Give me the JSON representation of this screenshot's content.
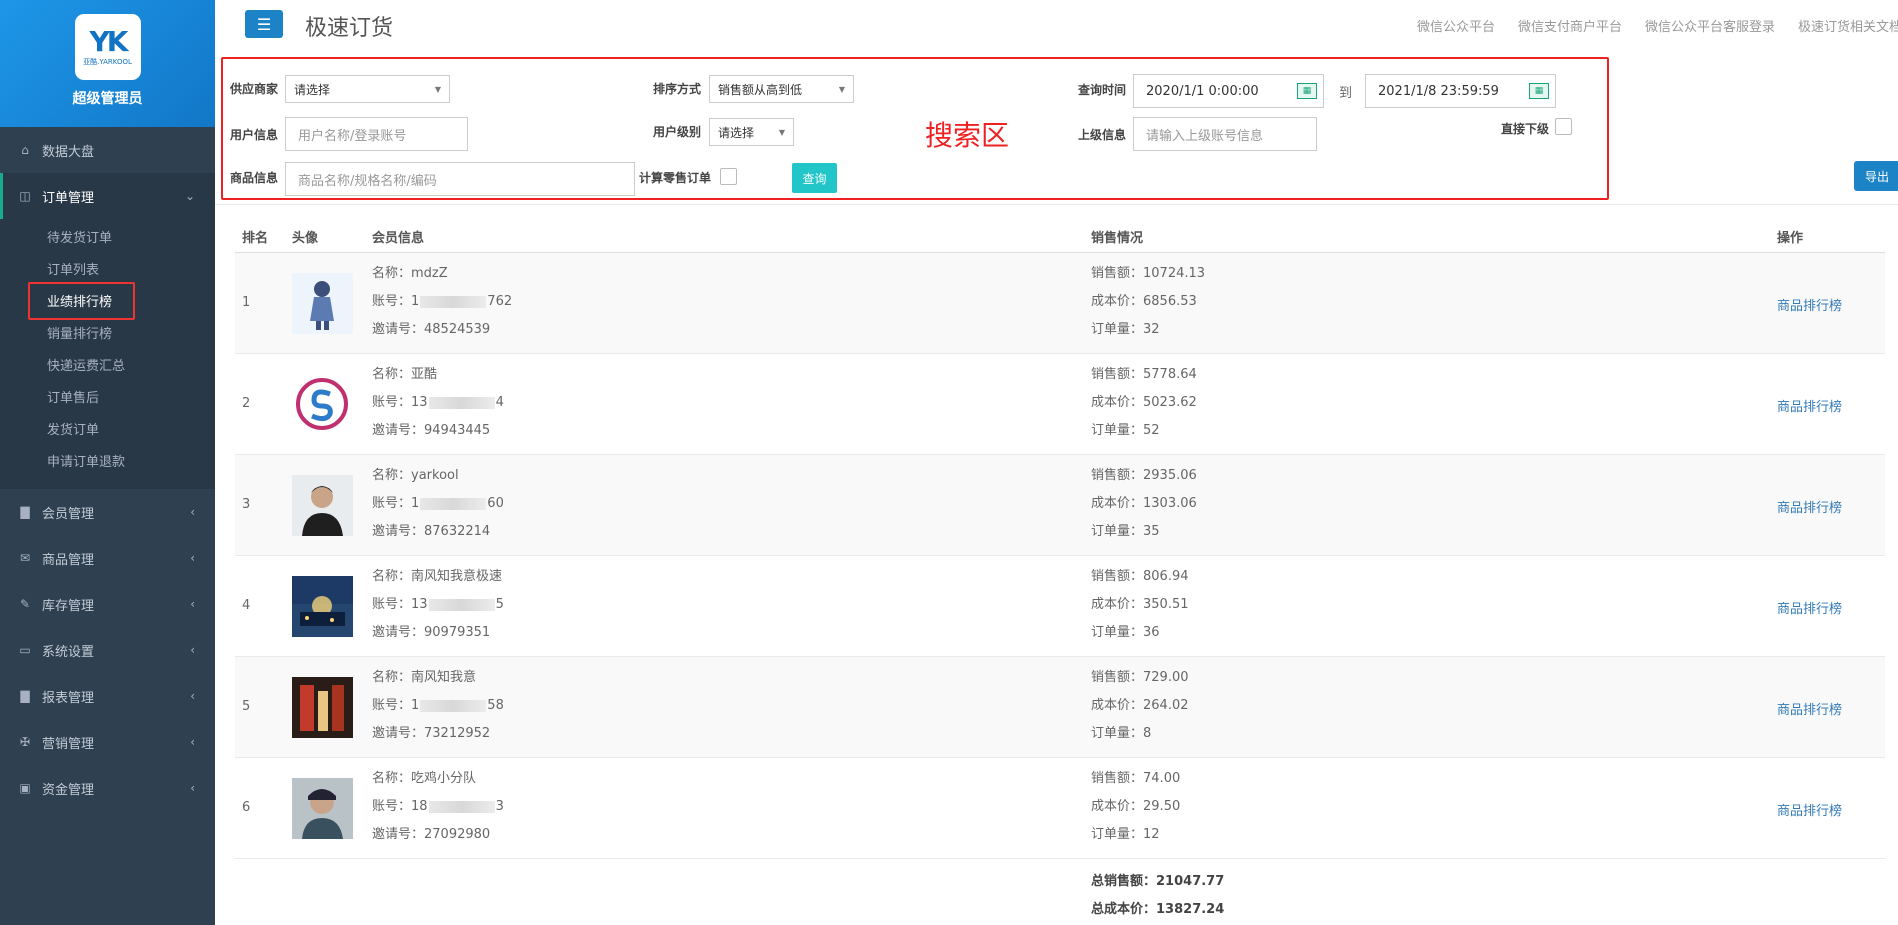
{
  "sidebar": {
    "admin_label": "超级管理员",
    "logo_text": "YK",
    "logo_sub": "亚酷.YARKOOL",
    "menu_top": {
      "label": "数据大盘",
      "icon": "home-icon"
    },
    "order_menu": {
      "label": "订单管理",
      "icon": "columns-icon"
    },
    "subitems": [
      {
        "label": "待发货订单"
      },
      {
        "label": "订单列表"
      },
      {
        "label": "业绩排行榜",
        "active": true
      },
      {
        "label": "销量排行榜"
      },
      {
        "label": "快递运费汇总"
      },
      {
        "label": "订单售后"
      },
      {
        "label": "发货订单"
      },
      {
        "label": "申请订单退款"
      }
    ],
    "menu_rest": [
      {
        "label": "会员管理",
        "icon": "bar-chart-icon"
      },
      {
        "label": "商品管理",
        "icon": "envelope-icon"
      },
      {
        "label": "库存管理",
        "icon": "edit-icon"
      },
      {
        "label": "系统设置",
        "icon": "desktop-icon"
      },
      {
        "label": "报表管理",
        "icon": "bar-chart-icon"
      },
      {
        "label": "营销管理",
        "icon": "cutlery-icon"
      },
      {
        "label": "资金管理",
        "icon": "money-icon"
      }
    ]
  },
  "header": {
    "title": "极速订货",
    "links": [
      "微信公众平台",
      "微信支付商户平台",
      "微信公众平台客服登录",
      "极速订货相关文档"
    ]
  },
  "search": {
    "area_label": "搜索区",
    "supplier_label": "供应商家",
    "supplier_value": "请选择",
    "sort_label": "排序方式",
    "sort_value": "销售额从高到低",
    "time_label": "查询时间",
    "time_start": "2020/1/1 0:00:00",
    "time_to": "到",
    "time_end": "2021/1/8 23:59:59",
    "user_label": "用户信息",
    "user_placeholder": "用户名称/登录账号",
    "level_label": "用户级别",
    "level_value": "请选择",
    "parent_label": "上级信息",
    "parent_placeholder": "请输入上级账号信息",
    "direct_label": "直接下级",
    "goods_label": "商品信息",
    "goods_placeholder": "商品名称/规格名称/编码",
    "retail_label": "计算零售订单",
    "query_button": "查询",
    "export_button": "导出"
  },
  "table": {
    "headers": {
      "rank": "排名",
      "avatar": "头像",
      "member": "会员信息",
      "sales": "销售情况",
      "op": "操作"
    },
    "name_prefix": "名称：",
    "account_prefix": "账号：",
    "invite_prefix": "邀请号：",
    "sales_prefix": "销售额：",
    "cost_prefix": "成本价：",
    "orders_prefix": "订单量：",
    "op_label": "商品排行榜",
    "rows": [
      {
        "rank": "1",
        "name": "mdzZ",
        "acc_a": "1",
        "acc_b": "762",
        "invite": "48524539",
        "sales": "10724.13",
        "cost": "6856.53",
        "orders": "32"
      },
      {
        "rank": "2",
        "name": "亚酷",
        "acc_a": "13",
        "acc_b": "4",
        "invite": "94943445",
        "sales": "5778.64",
        "cost": "5023.62",
        "orders": "52"
      },
      {
        "rank": "3",
        "name": "yarkool",
        "acc_a": "1",
        "acc_b": "60",
        "invite": "87632214",
        "sales": "2935.06",
        "cost": "1303.06",
        "orders": "35"
      },
      {
        "rank": "4",
        "name": "南风知我意极速",
        "acc_a": "13",
        "acc_b": "5",
        "invite": "90979351",
        "sales": "806.94",
        "cost": "350.51",
        "orders": "36"
      },
      {
        "rank": "5",
        "name": "南风知我意",
        "acc_a": "1",
        "acc_b": "58",
        "invite": "73212952",
        "sales": "729.00",
        "cost": "264.02",
        "orders": "8"
      },
      {
        "rank": "6",
        "name": "吃鸡小分队",
        "acc_a": "18",
        "acc_b": "3",
        "invite": "27092980",
        "sales": "74.00",
        "cost": "29.50",
        "orders": "12"
      }
    ]
  },
  "totals": {
    "sales_label": "总销售额：",
    "sales_value": "21047.77",
    "cost_label": "总成本价：",
    "cost_value": "13827.24"
  }
}
